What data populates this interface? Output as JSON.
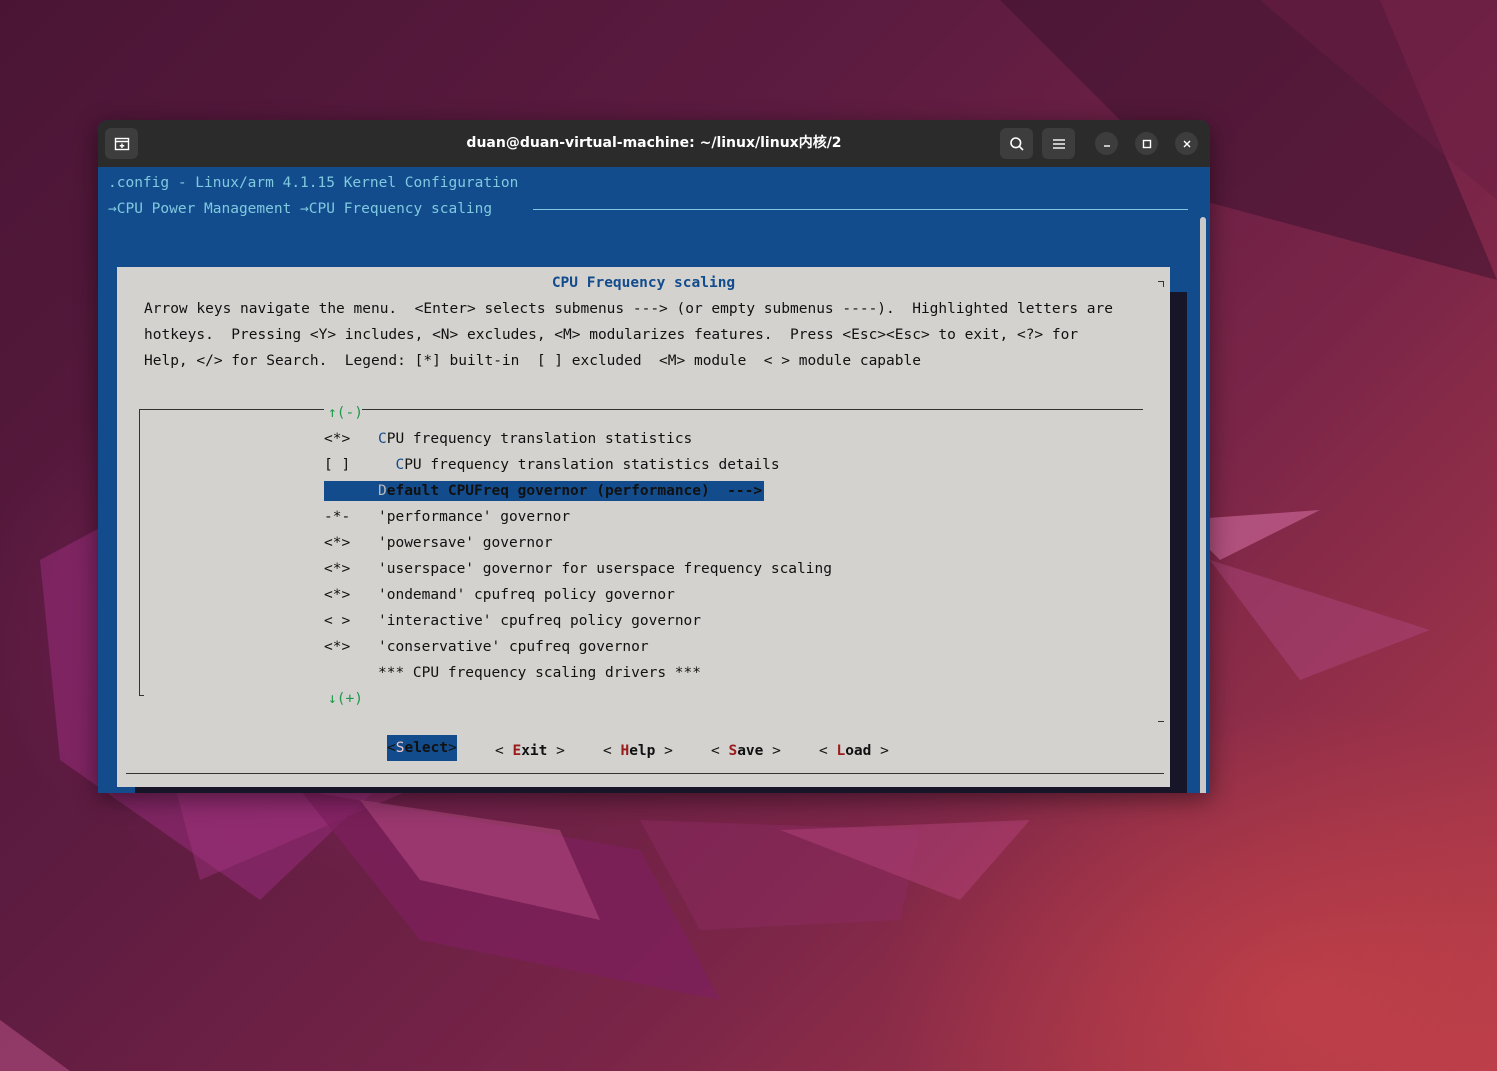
{
  "window": {
    "title": "duan@duan-virtual-machine: ~/linux/linux内核/2"
  },
  "terminal": {
    "header_line": ".config - Linux/arm 4.1.15 Kernel Configuration",
    "breadcrumb": "→CPU Power Management →CPU Frequency scaling"
  },
  "dialog": {
    "title": "CPU Frequency scaling",
    "help_lines": [
      "Arrow keys navigate the menu.  <Enter> selects submenus ---> (or empty submenus ----).  Highlighted letters are",
      "hotkeys.  Pressing <Y> includes, <N> excludes, <M> modularizes features.  Press <Esc><Esc> to exit, <?> for",
      "Help, </> for Search.  Legend: [*] built-in  [ ] excluded  <M> module  < > module capable"
    ],
    "scroll_up": "↑(-)",
    "scroll_down": "↓(+)",
    "items": [
      {
        "prefix": "<*>",
        "hotkey": "C",
        "rest": "PU frequency translation statistics",
        "indent": ""
      },
      {
        "prefix": "[ ]",
        "hotkey": "C",
        "rest": "PU frequency translation statistics details",
        "indent": "  "
      },
      {
        "prefix": "",
        "hotkey": "D",
        "rest": "efault CPUFreq governor (performance)  --->",
        "indent": "",
        "selected": true
      },
      {
        "prefix": "-*-",
        "hotkey": "'",
        "rest": "performance' governor",
        "indent": ""
      },
      {
        "prefix": "<*>",
        "hotkey": "'",
        "rest": "powersave' governor",
        "indent": ""
      },
      {
        "prefix": "<*>",
        "hotkey": "'",
        "rest": "userspace' governor for userspace frequency scaling",
        "indent": ""
      },
      {
        "prefix": "<*>",
        "hotkey": "'",
        "rest": "ondemand' cpufreq policy governor",
        "indent": ""
      },
      {
        "prefix": "< >",
        "hotkey": "'",
        "rest": "interactive' cpufreq policy governor",
        "indent": ""
      },
      {
        "prefix": "<*>",
        "hotkey": "'",
        "rest": "conservative' cpufreq governor",
        "indent": ""
      },
      {
        "prefix": "",
        "hotkey": "",
        "rest": "*** CPU frequency scaling drivers ***",
        "indent": ""
      }
    ],
    "buttons": [
      {
        "open": "<",
        "hotkey": "S",
        "rest": "elect",
        "close": ">",
        "selected": true
      },
      {
        "open": "< ",
        "hotkey": "E",
        "rest": "xit",
        "close": " >"
      },
      {
        "open": "< ",
        "hotkey": "H",
        "rest": "elp",
        "close": " >"
      },
      {
        "open": "< ",
        "hotkey": "S",
        "rest": "ave",
        "close": " >"
      },
      {
        "open": "< ",
        "hotkey": "L",
        "rest": "oad",
        "close": " >"
      }
    ]
  },
  "colors": {
    "terminal_bg": "#134c8c",
    "dialog_bg": "#d3d2cf",
    "title_blue": "#134c8c",
    "hotkey_red": "#9b1b1b",
    "scroll_arrow_green": "#1f9a4a",
    "header_cyan": "#7fc9e0",
    "selection_bg": "#134c8c"
  },
  "icons": [
    "new-tab-icon",
    "search-icon",
    "hamburger-menu-icon",
    "minimize-icon",
    "maximize-icon",
    "close-icon"
  ]
}
